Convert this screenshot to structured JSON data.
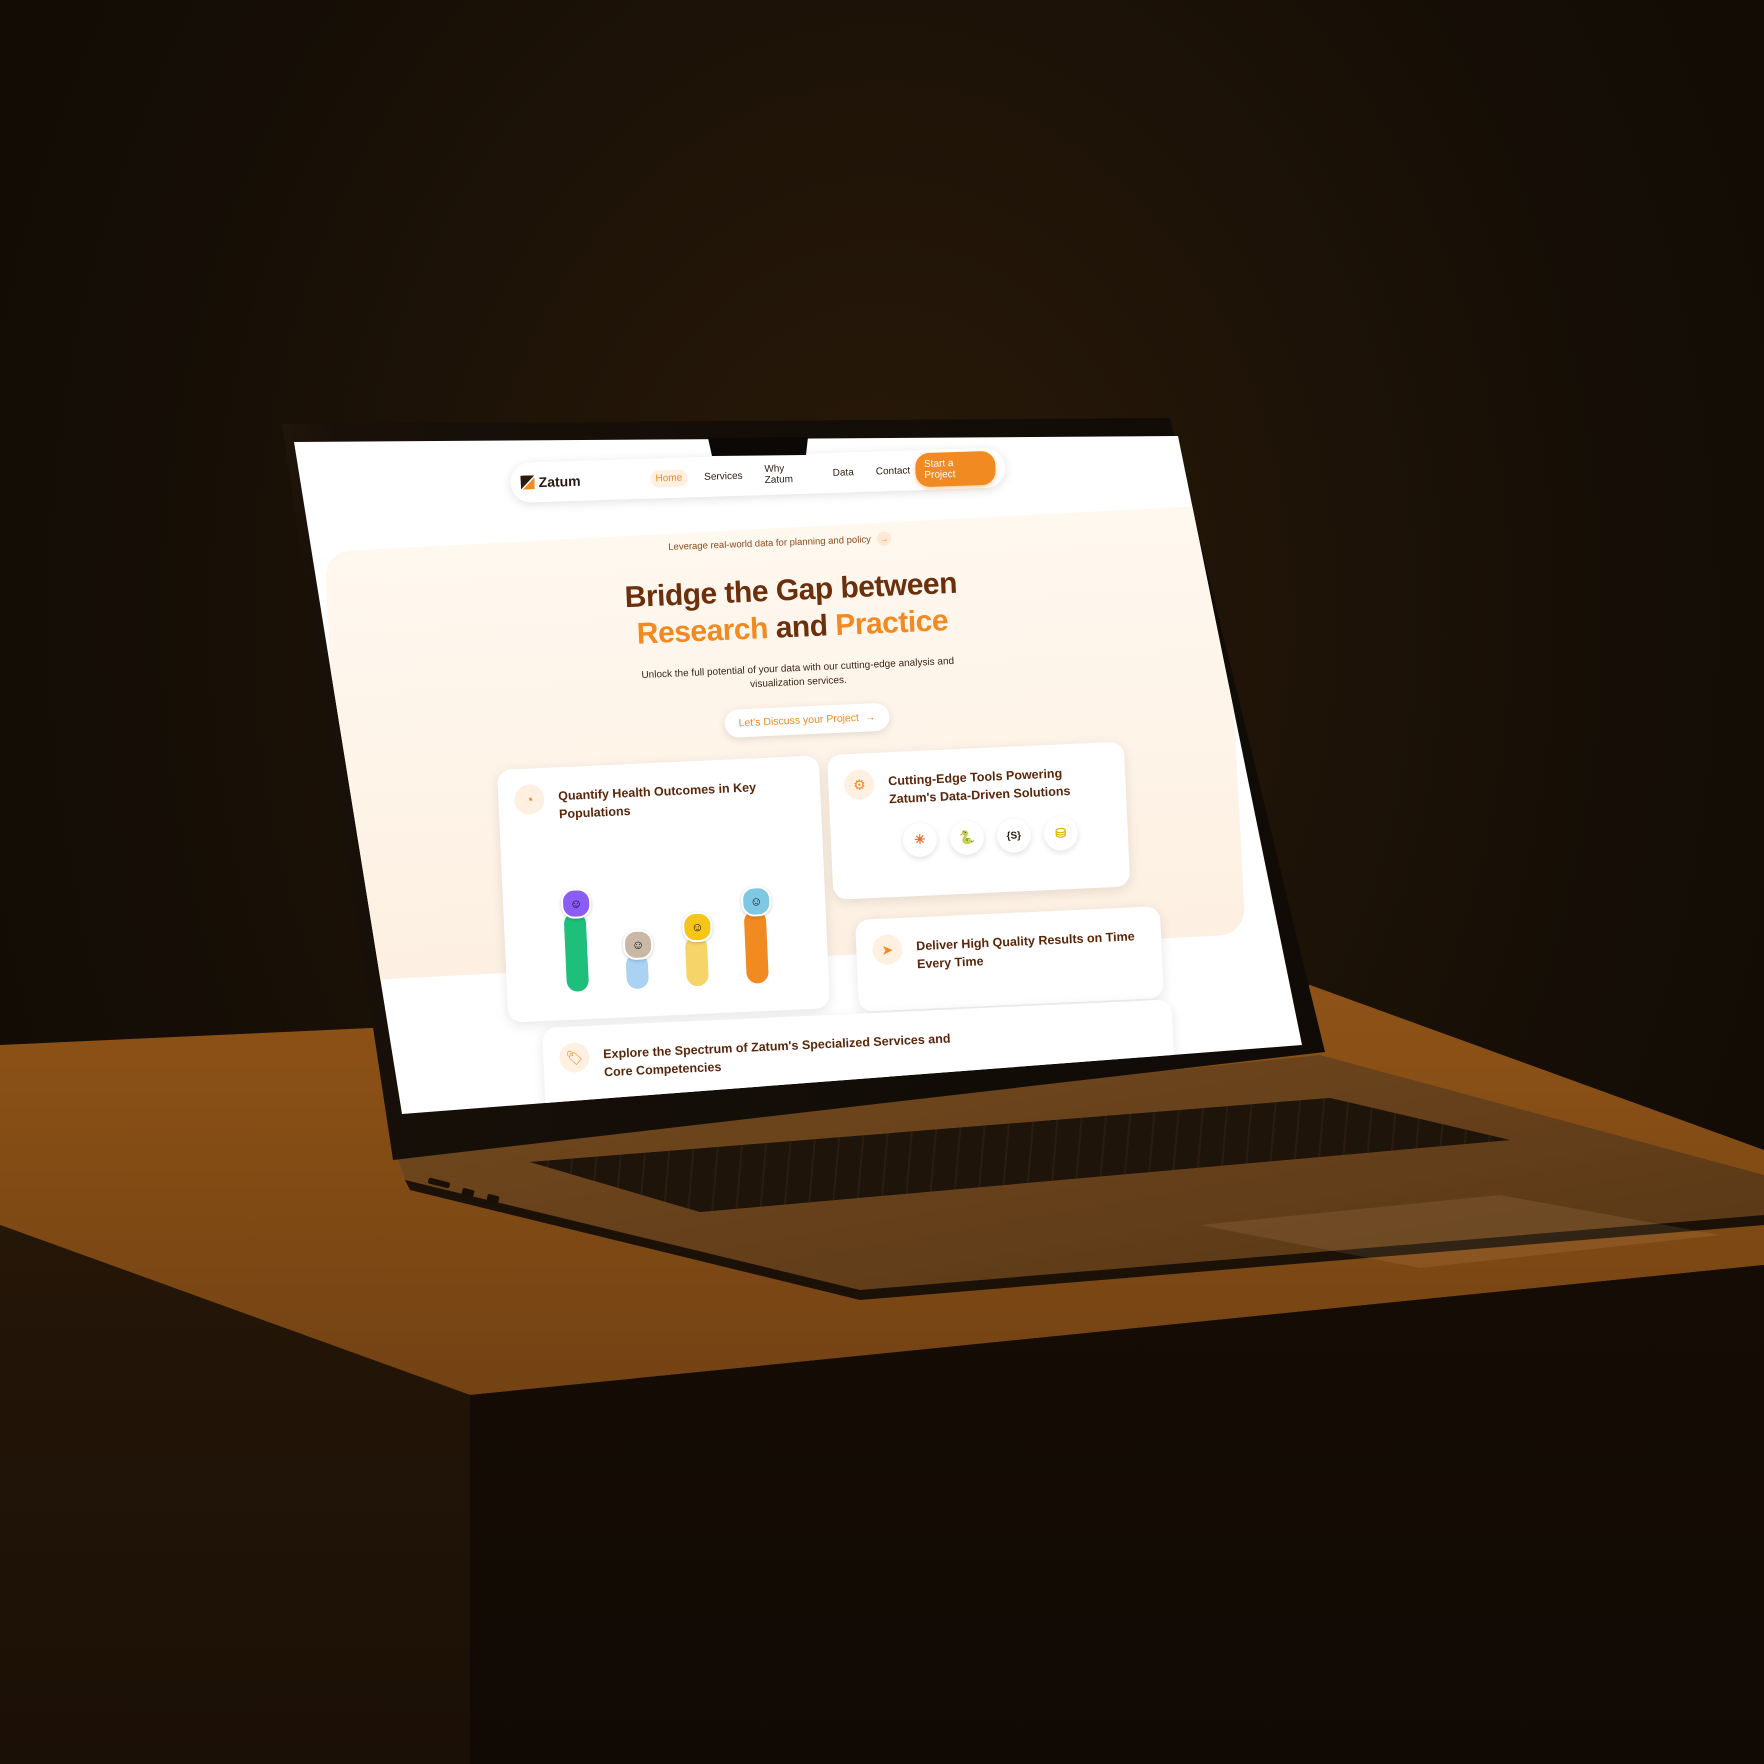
{
  "nav": {
    "logo": "Zatum",
    "links": [
      {
        "label": "Home",
        "active": true
      },
      {
        "label": "Services",
        "active": false
      },
      {
        "label": "Why Zatum",
        "active": false
      },
      {
        "label": "Data",
        "active": false
      },
      {
        "label": "Contact",
        "active": false
      }
    ],
    "cta": "Start a Project"
  },
  "hero": {
    "pill": "Leverage real-world data for planning and policy",
    "pill_arrow": "→",
    "headline_line1": "Bridge the Gap between",
    "headline_word1": "Research",
    "headline_and": "and",
    "headline_word2": "Practice",
    "subtext": "Unlock the full potential of your data with our cutting-edge analysis and visualization services.",
    "button": "Let's Discuss your Project",
    "button_arrow": "→"
  },
  "cards": {
    "health": {
      "title": "Quantify Health Outcomes in Key Populations",
      "icon": "pie-chart-icon",
      "bars": [
        {
          "level": 0.72,
          "color": "#1dbf7a",
          "avatar_bg": "#8b5cf6"
        },
        {
          "level": 0.32,
          "color": "#a9d2f3",
          "avatar_bg": "#c9b8a6"
        },
        {
          "level": 0.45,
          "color": "#f7d46a",
          "avatar_bg": "#f5c518"
        },
        {
          "level": 0.66,
          "color": "#f28a22",
          "avatar_bg": "#7ec8e3"
        }
      ]
    },
    "tools": {
      "title": "Cutting-Edge Tools Powering Zatum's Data-Driven Solutions",
      "icon": "gear-icon",
      "items": [
        {
          "name": "tableau-icon",
          "glyph": "✳"
        },
        {
          "name": "python-icon",
          "glyph": "🐍"
        },
        {
          "name": "sql-icon",
          "glyph": "{S}"
        },
        {
          "name": "database-icon",
          "glyph": "⛁"
        }
      ]
    },
    "results": {
      "title": "Deliver High Quality Results on Time Every Time",
      "icon": "send-icon"
    },
    "services": {
      "title": "Explore the Spectrum of Zatum's Specialized Services and Core Competencies",
      "icon": "tag-icon"
    }
  },
  "colors": {
    "accent": "#f28a22",
    "heading": "#6b2f0c"
  }
}
